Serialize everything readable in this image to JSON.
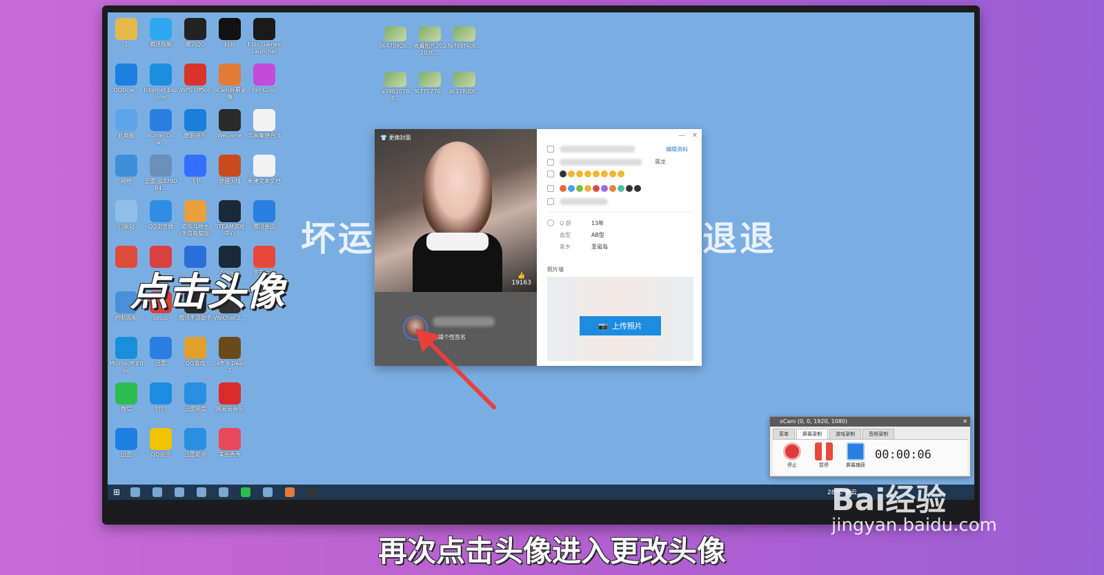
{
  "desktop": {
    "icons_col1": [
      {
        "label": "1",
        "icon": "user-folder-icon",
        "color": "#e6b84a"
      },
      {
        "label": "QQDow...",
        "icon": "qq-download-icon",
        "color": "#1d7fe0"
      },
      {
        "label": "此电脑",
        "icon": "computer-icon",
        "color": "#5ea4e8"
      },
      {
        "label": "网络",
        "icon": "network-icon",
        "color": "#3d8fd9"
      },
      {
        "label": "回收站",
        "icon": "recycle-bin-icon",
        "color": "#8fbfe8"
      },
      {
        "label": "",
        "icon": "chrome-icon",
        "color": "#dd4b39"
      },
      {
        "label": "控制面板",
        "icon": "control-panel-icon",
        "color": "#4a90d9"
      },
      {
        "label": "Microsoft Edge",
        "icon": "edge-icon",
        "color": "#1a8fd9"
      },
      {
        "label": "微信",
        "icon": "wechat-icon",
        "color": "#2dbd4e"
      },
      {
        "label": "迅雷",
        "icon": "app-icon",
        "color": "#1d7fe0"
      }
    ],
    "icons_col2": [
      {
        "label": "腾讯视频",
        "icon": "tencent-video-icon",
        "color": "#2fa8f0"
      },
      {
        "label": "Internet Explorer",
        "icon": "ie-icon",
        "color": "#1c8ee0"
      },
      {
        "label": "xunlei Dow...",
        "icon": "xunlei-icon",
        "color": "#2a7fe0"
      },
      {
        "label": "迅雷 @279084...",
        "icon": "installer-icon",
        "color": "#6a8fb8"
      },
      {
        "label": "QQ浏览器",
        "icon": "qq-browser-icon",
        "color": "#2f8de4"
      },
      {
        "label": "",
        "icon": "red-app-icon",
        "color": "#d94040"
      },
      {
        "label": "setup",
        "icon": "setup-icon",
        "color": "#d94040"
      },
      {
        "label": "迅雷",
        "icon": "thunder-icon",
        "color": "#2a7fe0"
      },
      {
        "label": "钉钉",
        "icon": "dingtalk-icon",
        "color": "#1d8ce0"
      },
      {
        "label": "QQ音乐",
        "icon": "qq-music-icon",
        "color": "#f2c200"
      }
    ],
    "icons_col3": [
      {
        "label": "腾讯QQ",
        "icon": "qq-icon",
        "color": "#222222"
      },
      {
        "label": "WPS Office",
        "icon": "wps-icon",
        "color": "#d9342b"
      },
      {
        "label": "酷狗音乐",
        "icon": "kugou-icon",
        "color": "#1a7fd9"
      },
      {
        "label": "飞书",
        "icon": "feishu-icon",
        "color": "#3370ff"
      },
      {
        "label": "欢乐斗地主(手游电脑版)",
        "icon": "game-icon",
        "color": "#e8a13c"
      },
      {
        "label": "",
        "icon": "sogou-icon",
        "color": "#2a6fd9"
      },
      {
        "label": "腾讯手游助手",
        "icon": "assistant-icon",
        "color": "#2a2a2a"
      },
      {
        "label": "QQ游戏",
        "icon": "qq-game-icon",
        "color": "#e3a02a"
      },
      {
        "label": "迅雷网盘",
        "icon": "cloud-drive-icon",
        "color": "#2a8fe0"
      },
      {
        "label": "迅雷影音",
        "icon": "player-icon",
        "color": "#2a8fe0"
      }
    ],
    "icons_col4": [
      {
        "label": "抖音",
        "icon": "douyin-icon",
        "color": "#111111"
      },
      {
        "label": "oCam屏幕录像",
        "icon": "ocam-icon",
        "color": "#e27a3a"
      },
      {
        "label": "WeGame",
        "icon": "wegame-icon",
        "color": "#2a2a2a"
      },
      {
        "label": "穿越火线",
        "icon": "cf-icon",
        "color": "#c84a1e"
      },
      {
        "label": "STEAM游戏中心",
        "icon": "steam-icon",
        "color": "#1b2838"
      },
      {
        "label": "Steam",
        "icon": "steam-icon-2",
        "color": "#1b2838"
      },
      {
        "label": "WeChat 2...",
        "icon": "folder-icon",
        "color": "#333333"
      },
      {
        "label": "Left 4 Dead 2",
        "icon": "l4d2-icon",
        "color": "#6a4a1a"
      },
      {
        "label": "网易云音乐",
        "icon": "netease-music-icon",
        "color": "#d92b2b"
      },
      {
        "label": "美图秀秀",
        "icon": "meitu-icon",
        "color": "#e8485a"
      }
    ],
    "icons_col5": [
      {
        "label": "Epic Games Launcher",
        "icon": "epic-icon",
        "color": "#1a1a1a"
      },
      {
        "label": "Fall Guys",
        "icon": "fall-guys-icon",
        "color": "#c44ad9"
      },
      {
        "label": "工具集锦合.5",
        "icon": "file-icon",
        "color": "#f2f2f2"
      },
      {
        "label": "新建文本文档",
        "icon": "text-file-icon",
        "color": "#f2f2f2"
      },
      {
        "label": "腾讯会议",
        "icon": "meeting-icon",
        "color": "#2a7fe0"
      },
      {
        "label": "金舟录屏",
        "icon": "recorder-icon",
        "color": "#e8483a"
      }
    ],
    "thumbs_row1": [
      {
        "label": "0647092b...",
        "icon": "image-thumb-icon"
      },
      {
        "label": "收藏图片2022030...",
        "icon": "image-thumb-icon"
      },
      {
        "label": "fe788f4c8...",
        "icon": "image-thumb-icon"
      }
    ],
    "thumbs_row2": [
      {
        "label": "a39610787...",
        "icon": "image-thumb-icon"
      },
      {
        "label": "f6775776...",
        "icon": "image-thumb-icon"
      },
      {
        "label": "4c178d0f...",
        "icon": "image-thumb-icon"
      }
    ],
    "bg_text_left": "坏运",
    "bg_text_right": "退退"
  },
  "overlay_caption": "点击头像",
  "profile_window": {
    "cover_title": "更换封面",
    "likes": "19163",
    "edit_link": "编辑资料",
    "sign_label": "编辑个性签名",
    "sign_name_hint": "属龙",
    "fields": [
      {
        "key": "Q 龄",
        "value": "13年"
      },
      {
        "key": "血型",
        "value": "AB型"
      },
      {
        "key": "家乡",
        "value": "圣诞岛"
      }
    ],
    "photo_wall_label": "照片墙",
    "upload_button": "上传照片",
    "win_min": "—",
    "win_close": "✕"
  },
  "taskbar": {
    "start": "⊞",
    "weather": "28°C 多云",
    "accent": "#1f3750"
  },
  "ocam": {
    "title": "oCam (0, 0, 1920, 1080)",
    "close": "✕",
    "tabs": [
      "菜单",
      "屏幕录制",
      "游戏录制",
      "音频录制"
    ],
    "buttons": [
      {
        "label": "停止",
        "icon": "stop-icon"
      },
      {
        "label": "暂停",
        "icon": "pause-icon"
      },
      {
        "label": "屏幕捕获",
        "icon": "monitor-icon"
      }
    ],
    "timer": "00:00:06"
  },
  "subtitle": "再次点击头像进入更改头像",
  "watermark": {
    "logo": "Bai经验",
    "url": "jingyan.baidu.com"
  }
}
